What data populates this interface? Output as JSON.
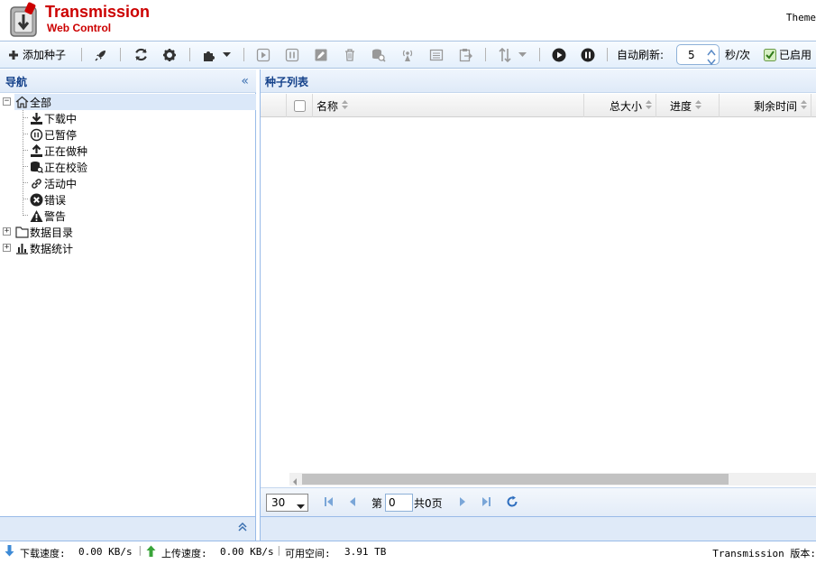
{
  "header": {
    "title_main": "Transmission",
    "title_sub": "Web Control",
    "theme_label": "Theme"
  },
  "toolbar": {
    "add_torrent_label": "添加种子",
    "auto_refresh_label": "自动刷新:",
    "refresh_interval": "5",
    "refresh_unit": "秒/次",
    "enabled_label": "已启用",
    "enabled_checked": true
  },
  "nav": {
    "title": "导航",
    "root": "全部",
    "items": [
      {
        "label": "下载中",
        "icon": "download-icon"
      },
      {
        "label": "已暂停",
        "icon": "pause-icon"
      },
      {
        "label": "正在做种",
        "icon": "upload-icon"
      },
      {
        "label": "正在校验",
        "icon": "check-icon"
      },
      {
        "label": "活动中",
        "icon": "link-icon"
      },
      {
        "label": "错误",
        "icon": "error-icon"
      },
      {
        "label": "警告",
        "icon": "warning-icon"
      }
    ],
    "folders": [
      {
        "label": "数据目录",
        "icon": "folder-icon"
      },
      {
        "label": "数据统计",
        "icon": "stats-icon"
      }
    ]
  },
  "main": {
    "title": "种子列表",
    "columns": [
      "名称",
      "总大小",
      "进度",
      "剩余时间"
    ],
    "pager": {
      "page_size": "30",
      "page_prefix": "第",
      "page_value": "0",
      "page_total": "共0页"
    }
  },
  "status": {
    "download_label": "下载速度:",
    "download_value": "0.00 KB/s",
    "upload_label": "上传速度:",
    "upload_value": "0.00 KB/s",
    "space_label": "可用空间:",
    "space_value": "3.91 TB",
    "version_label": "Transmission 版本:"
  },
  "colors": {
    "brand": "#cc0000",
    "panel_title": "#15428b",
    "border": "#99bbe8"
  }
}
